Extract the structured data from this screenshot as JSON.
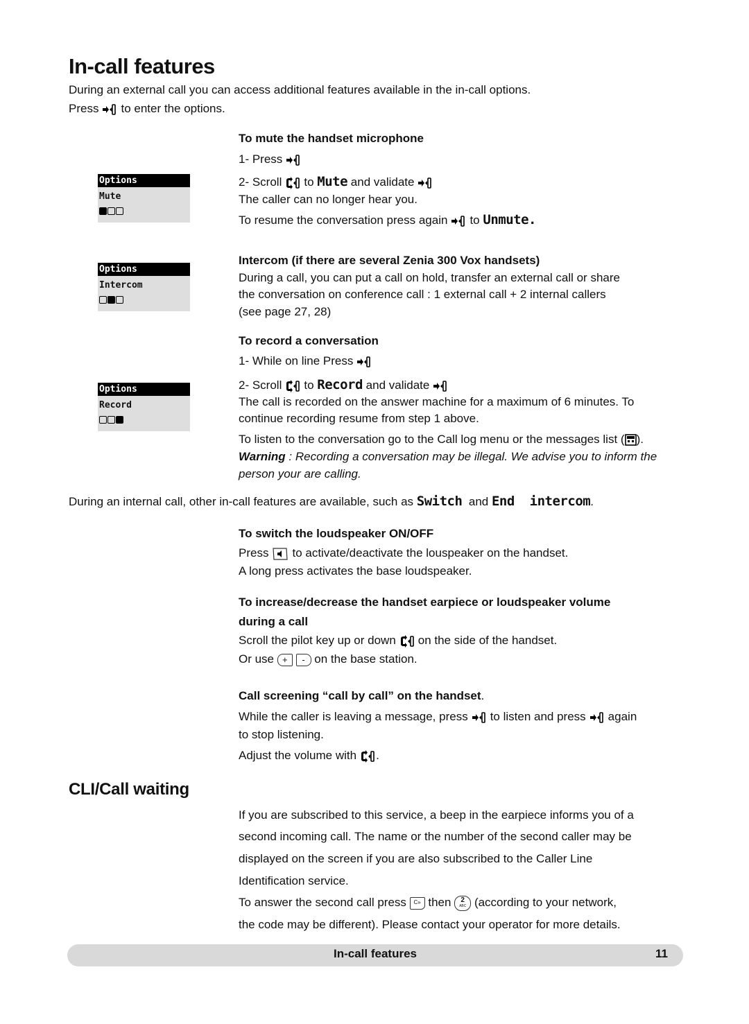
{
  "title": "In-call features",
  "intro": {
    "line1": "During an external call you can access additional features available in the in-call options.",
    "line2_pre": "Press",
    "line2_post": "to enter the options."
  },
  "lcd_screens": [
    {
      "header": "Options",
      "item": "Mute",
      "active_index": 0
    },
    {
      "header": "Options",
      "item": "Intercom",
      "active_index": 1
    },
    {
      "header": "Options",
      "item": "Record",
      "active_index": 2
    }
  ],
  "mute": {
    "heading": "To mute the handset microphone",
    "step1": "1- Press",
    "step2_pre": "2- Scroll",
    "step2_to": "to",
    "step2_word": "Mute",
    "step2_post": "and validate",
    "result": "The caller can no longer hear you.",
    "resume_pre": "To resume the conversation press again",
    "resume_to": "to",
    "resume_word": "Unmute."
  },
  "intercom": {
    "heading": "Intercom (if there are several Zenia 300 Vox handsets)",
    "line1": "During a call, you can put a call on hold, transfer an external call or share",
    "line2": "the conversation on conference call : 1 external call + 2 internal callers",
    "line3": "(see page 27, 28)"
  },
  "record": {
    "heading": "To record a conversation",
    "step1": "1- While on line Press",
    "step2_pre": "2- Scroll",
    "step2_to": "to",
    "step2_word": "Record",
    "step2_post": "and validate",
    "info1": "The call is recorded on the answer machine for a maximum of 6 minutes. To",
    "info2": "continue recording resume from step 1 above.",
    "listen_pre": "To listen to the conversation go to the Call log menu or the messages list (",
    "listen_post": ").",
    "warning_label": "Warning",
    "warning_text1": " : Recording a conversation may be illegal. We advise you to inform the",
    "warning_text2": "person your are calling."
  },
  "internal": {
    "pre": "During an internal call, other in-call features are available, such as",
    "word1": "Switch",
    "and": "and",
    "word2": "End  intercom",
    "post": "."
  },
  "loudspeaker": {
    "heading": "To switch the loudspeaker ON/OFF",
    "line1_pre": "Press",
    "line1_post": "to activate/deactivate the louspeaker on the handset.",
    "line2": "A long press activates the base loudspeaker."
  },
  "volume": {
    "heading1": "To increase/decrease the handset earpiece or loudspeaker volume",
    "heading2": "during a call",
    "line1_pre": "Scroll the pilot key up or down",
    "line1_post": "on the side of the handset.",
    "line2_pre": "Or use",
    "line2_post": "on the base station.",
    "plus": "+",
    "minus": "-"
  },
  "screening": {
    "heading": "Call screening “call by call” on the handset",
    "heading_dot": ".",
    "line1_pre": "While the caller is leaving a message, press",
    "line1_mid": "to listen and press",
    "line1_post": "again",
    "line2": "to stop listening.",
    "line3_pre": "Adjust the volume with",
    "line3_post": "."
  },
  "cli": {
    "heading": "CLI/Call waiting",
    "p1": "If you are subscribed to this service, a beep in the earpiece informs you of a",
    "p2": "second incoming call. The name or the number of the second caller may be",
    "p3": "displayed on the screen if you are also subscribed to the Caller Line",
    "p4": "Identification service.",
    "p5_pre": "To answer the second call press",
    "p5_mid": "then",
    "p5_post": "(according to your network,",
    "p6": "the code may be different). Please contact your operator for more details.",
    "key_r": "C»",
    "key_2": "2",
    "key_2_sub": "ABC"
  },
  "footer": {
    "title": "In-call features",
    "page": "11"
  }
}
